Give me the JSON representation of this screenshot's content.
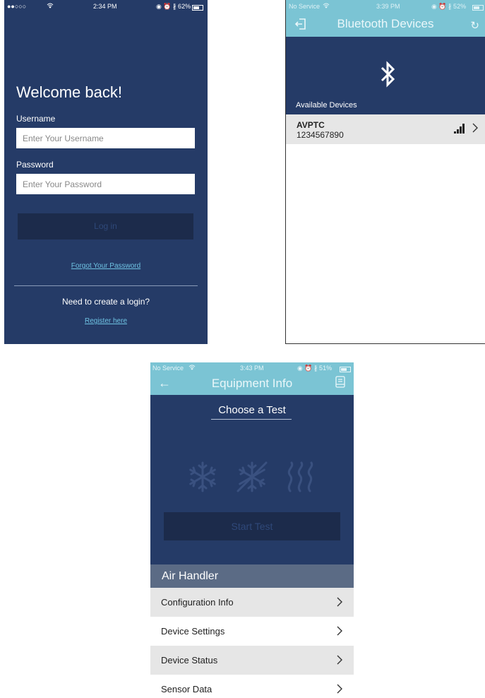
{
  "login": {
    "status": {
      "signal": "●●○○○",
      "time": "2:34 PM",
      "icons": "◉ ⏰ ∦ 62%"
    },
    "title": "Welcome back!",
    "username_label": "Username",
    "username_placeholder": "Enter Your Username",
    "password_label": "Password",
    "password_placeholder": "Enter Your Password",
    "login_button": "Log in",
    "forgot_link": "Forgot Your Password",
    "need_login": "Need to create a login?",
    "register_link": "Register here"
  },
  "bluetooth": {
    "status": {
      "carrier": "No Service",
      "time": "3:39 PM",
      "icons": "◉ ⏰ ∦ 52%"
    },
    "nav_title": "Bluetooth Devices",
    "available_label": "Available Devices",
    "devices": [
      {
        "name": "AVPTC",
        "id": "1234567890"
      }
    ]
  },
  "equipment": {
    "status": {
      "carrier": "No Service",
      "time": "3:43 PM",
      "icons": "◉ ⏰ ∦ 51%"
    },
    "nav_title": "Equipment Info",
    "choose_label": "Choose a Test",
    "start_button": "Start Test",
    "section_title": "Air Handler",
    "menu": [
      {
        "label": "Configuration Info"
      },
      {
        "label": "Device Settings"
      },
      {
        "label": "Device Status"
      },
      {
        "label": "Sensor Data"
      }
    ]
  },
  "colors": {
    "navy": "#253b67",
    "teal": "#7bc4d4",
    "link": "#6fc3e3",
    "section": "#5b6b85"
  },
  "icons": [
    "wifi-icon",
    "battery-icon",
    "login-back-icon",
    "refresh-icon",
    "bluetooth-icon",
    "signal-strength-icon",
    "chevron-right-icon",
    "back-arrow-icon",
    "manual-book-icon",
    "snowflake-icon",
    "defrost-icon",
    "heat-icon"
  ]
}
